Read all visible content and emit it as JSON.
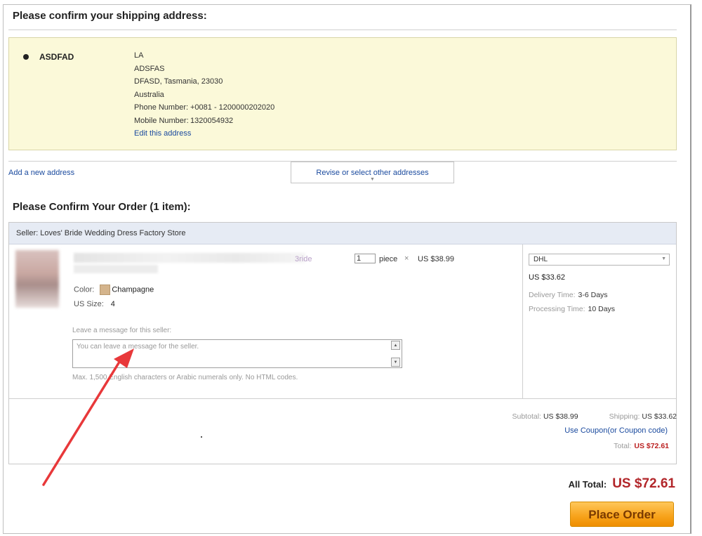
{
  "shipping": {
    "title": "Please confirm your shipping address:",
    "address": {
      "name": "ASDFAD",
      "line1": "LA",
      "line2": "ADSFAS",
      "line3": "DFASD, Tasmania, 23030",
      "country": "Australia",
      "phone_label": "Phone Number:",
      "phone_value": "+0081 - 1200000202020",
      "mobile_label": "Mobile Number:",
      "mobile_value": "1320054932",
      "edit_link": "Edit this address"
    },
    "add_new_link": "Add a new address",
    "revise_button": "Revise or select other addresses"
  },
  "order": {
    "title": "Please Confirm Your Order (1 item):",
    "seller": "Seller: Loves' Bride Wedding Dress Factory Store",
    "item": {
      "name_tail": "3ride",
      "color_label": "Color:",
      "color_value": "Champagne",
      "swatch_color": "#d4b48c",
      "size_label": "US Size:",
      "size_value": "4",
      "quantity": "1",
      "unit": "piece",
      "times": "×",
      "price": "US $38.99"
    },
    "message": {
      "label": "Leave a message for this seller:",
      "placeholder": "You can leave a message for the seller.",
      "hint": "Max. 1,500 English characters or Arabic numerals only. No HTML codes."
    },
    "shipping_method": {
      "selected": "DHL",
      "cost": "US $33.62",
      "delivery_label": "Delivery Time:",
      "delivery_value": "3-6 Days",
      "processing_label": "Processing Time:",
      "processing_value": "10 Days"
    },
    "summary": {
      "subtotal_label": "Subtotal:",
      "subtotal_value": "US $38.99",
      "shipping_label": "Shipping:",
      "shipping_value": "US $33.62",
      "coupon_link": "Use Coupon(or Coupon code)",
      "total_label": "Total:",
      "total_value": "US $72.61"
    }
  },
  "footer": {
    "all_total_label": "All Total:",
    "all_total_value": "US $72.61",
    "place_order_label": "Place Order"
  },
  "colors": {
    "address_bg": "#fbf9d9",
    "seller_bar_bg": "#e6ebf4",
    "link": "#1a4a9e",
    "total_red": "#b2262a",
    "button_orange": "#f7a21a",
    "annotation_arrow": "#e8383a"
  }
}
